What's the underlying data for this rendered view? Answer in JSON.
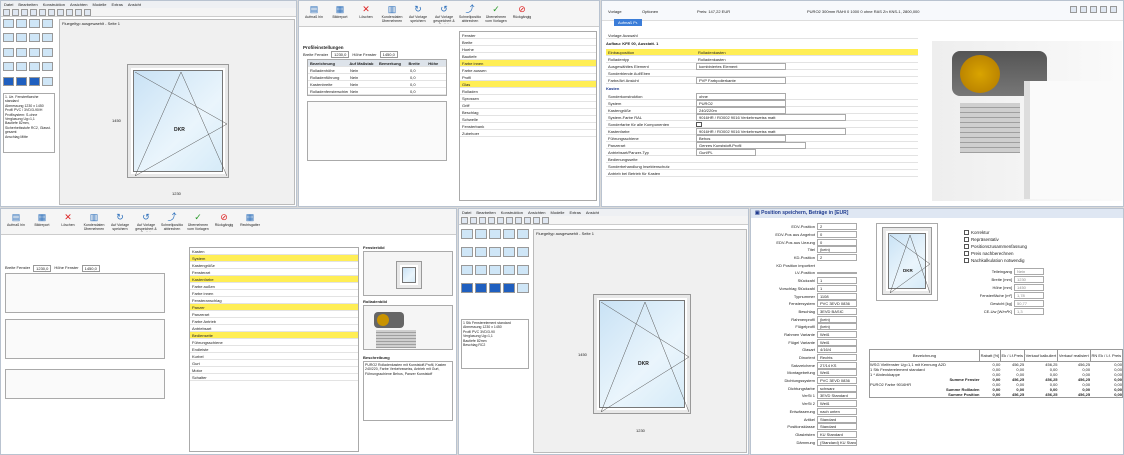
{
  "p1": {
    "menu": [
      "Datei",
      "Bearbeiten",
      "Konstruktion",
      "Ansichten",
      "Modelle",
      "Extras",
      "Ansicht"
    ],
    "tab": "Fluegeltyp ausgewaehlt - Seite 1",
    "win_label": "DKR",
    "info_lines": [
      "1. Ue. Fensterflaeche standard",
      "Abmessung 1230 x 1450",
      "Profil PVC / 3VD/3-90/H",
      "Profilsystem: S-ohne",
      "Verglasung Ug=1,1",
      "Bautiefe 82mm, Sicherheitsstufe RC2, Glasst. gesamt",
      "Anschlag Mitte"
    ],
    "dim_bottom": "1230",
    "dim_side": "1450"
  },
  "p2": {
    "toolbar": [
      "Aufmaß hin",
      "Bildreport",
      "Löschen",
      "Kundendaten Übernehmen",
      "Auf Vorlage speichern",
      "Auf Vorlage gespeichert & Zurück",
      "Schnellpositionen abbrechen",
      "Übernehmen vom Vorlagen",
      "Rückgängig"
    ],
    "section1": "Profileinstellungen",
    "breite_label": "Breite Fenster",
    "breite_val": "1230,0",
    "hoehe_label": "Höhe Fenster",
    "hoehe_val": "1450,0",
    "table_cols": [
      "Bezeichnung",
      "Auf Maßstab",
      "Bemerkung",
      "Breite",
      "Höhe"
    ],
    "table_rows": [
      [
        "Rolladenhöhe",
        "Nein",
        "",
        "0,0"
      ],
      [
        "Rolladenführung",
        "Nein",
        "",
        "0,0"
      ],
      [
        "Kastenbreite",
        "Nein",
        "",
        "0,0"
      ],
      [
        "Rolladenfensterschiene",
        "Nein",
        "",
        "0,0"
      ]
    ],
    "rechts_list": [
      "Fenster",
      "Breite",
      "Hoehe",
      "Bautiefe",
      "Farbe innen",
      "Farbe aussen",
      "Profil",
      "Glas",
      "Rolladen",
      "Sprossen",
      "Griff",
      "Beschlag",
      "Schwelle",
      "Fensterbank",
      "Zubehoer"
    ]
  },
  "p3": {
    "tabs": [
      "Vorlage",
      "Optionen"
    ],
    "tab_active": "Aufmaß Pr.",
    "price": "Preis: 147,22 EUR",
    "title_right": "PURO2 300mm RAHI 0 1000 0 ohne RAS Zn KNS-1, 2800,000",
    "header_line": "Aufbau: KFE 00, Ausstatt. 1",
    "fields": [
      {
        "l": "Vorlage Auswahl",
        "v": ""
      },
      {
        "l": "Einbauposition",
        "v": "Rolladenkasten"
      },
      {
        "l": "Rolladentyp",
        "v": "Rolladenkasten"
      },
      {
        "l": "Ausgewähltes Element",
        "v": "kombiniertes Element"
      },
      {
        "l": "Sonderblende Auf/Eben",
        "v": ""
      },
      {
        "l": "Farbe/Art Ansicht",
        "v": "PVP Farbpolierkante"
      }
    ],
    "section": "Kasten",
    "fields2": [
      {
        "l": "Sonderkonstruktion",
        "v": "ohne"
      },
      {
        "l": "System",
        "v": "PURO2"
      },
      {
        "l": "Kastengröße",
        "v": "240/220m"
      },
      {
        "l": "System-Farbe RAL",
        "v": "9016HR / RO002 9016 Verkehrsweiss matt"
      },
      {
        "l": "Sonderfarbe für alle Komponenten",
        "v": ""
      },
      {
        "l": "Kastenfarbe",
        "v": "9016HR / RO002 9016 Verkehrsweiss matt"
      },
      {
        "l": "Führungsschiene",
        "v": "Behos"
      },
      {
        "l": "Panzerart",
        "v": "Genres Kunststoff-Profil"
      },
      {
        "l": "Antriebsart/Panzer-Typ",
        "v": "Gurt/PL"
      },
      {
        "l": "Bedienungsseite",
        "v": ""
      },
      {
        "l": "Sonderbehandlung Insektenschutz",
        "v": ""
      },
      {
        "l": "Antrieb bei Betrieb für Kasten",
        "v": ""
      }
    ]
  },
  "p4": {
    "toolbar": [
      "Aufmaß hin",
      "Bildreport",
      "Löschen",
      "Kundendaten Übernehmen",
      "Auf Vorlage speichern",
      "Auf Vorlage gespeichert & Zurück",
      "Schnellpositionen abbrechen",
      "Übernehmen vom Vorlagen",
      "Rückgängig",
      "Rechtsgatter"
    ],
    "breite_val": "1230,0",
    "hoehe_val": "1450,0",
    "mid_rows": [
      "Kasten",
      "System",
      "Kastengröße",
      "Fensterart",
      "Kastenfarbe",
      "Farbe außen",
      "Farbe innen",
      "Fensteranschlag",
      "Panzer",
      "Panzerart",
      "Farbe Antrieb",
      "Antriebsart",
      "Bedienseite",
      "Führungsschiene",
      "Endleiste",
      "Kurbel",
      "Gurt",
      "Motor",
      "Schalter"
    ],
    "preview_title": "Fensterbild",
    "preview2_title": "Rolladenbild",
    "desc_title": "Beschreibung",
    "desc": "PURO2 Rolladenkasten mit Kunststoff-Profil, Kasten 240/220, Farbe Verkehrsweiss, Antrieb mit Gurt, Führungsschiene Behos, Panzer Kunststoff"
  },
  "p5": {
    "menu": [
      "Datei",
      "Bearbeiten",
      "Konstruktion",
      "Ansichten",
      "Modelle",
      "Extras",
      "Ansicht"
    ],
    "tab": "Fluegeltyp ausgewaehlt - Seite 1",
    "win_label": "DKR",
    "info_lines": [
      "1 Stk Fensterelement standard",
      "Abmessung 1230 x 1450",
      "Profil PVC 3VD/3-90",
      "Verglasung Ug=1,1",
      "Bautiefe 82mm",
      "Beschlag RC2"
    ],
    "dim_bottom": "1230",
    "dim_side": "1450"
  },
  "p6": {
    "title": "Position speichern, Beträge in [EUR]",
    "fields": [
      {
        "l": "EDV-Position",
        "v": "2"
      },
      {
        "l": "EDV-Pos aus Angebot",
        "v": "0"
      },
      {
        "l": "EDV-Pos aus Uezung",
        "v": "0"
      },
      {
        "l": "Titel",
        "v": "(kein)"
      },
      {
        "l": "KD-Position",
        "v": "2"
      },
      {
        "l": "KD Position importiert",
        "v": ""
      },
      {
        "l": "LV-Position",
        "v": ""
      },
      {
        "l": "Stückzahl",
        "v": "1"
      },
      {
        "l": "Vorschlag Stückzahl",
        "v": "1"
      },
      {
        "l": "Typnummer",
        "v": "1108"
      },
      {
        "l": "Fenstersystem",
        "v": "PVC 3EVD 0836"
      },
      {
        "l": "Beschlag",
        "v": "3EVD BASIC"
      },
      {
        "l": "Rahmenprofil",
        "v": "(kein)"
      },
      {
        "l": "Flügelprofil",
        "v": "(kein)"
      },
      {
        "l": "Rahmen Variante",
        "v": "Weiß"
      },
      {
        "l": "Flügel Variante",
        "v": "Weiß"
      },
      {
        "l": "Glasart",
        "v": "4/16/4"
      },
      {
        "l": "Dinorient",
        "v": "Rechts"
      },
      {
        "l": "Satzzeichene",
        "v": "27/14 KS"
      },
      {
        "l": "Montagebefung",
        "v": "Weiß"
      },
      {
        "l": "Dichtungssystem",
        "v": "PVC 3EVD 0836"
      },
      {
        "l": "Dichtungsfarbe",
        "v": "schwarz"
      },
      {
        "l": "VerSt 1",
        "v": "3EVD Standard"
      },
      {
        "l": "VerSt 2",
        "v": "Weiß"
      },
      {
        "l": "Entwässerung",
        "v": "nach unten"
      },
      {
        "l": "Artikel",
        "v": "Standard"
      },
      {
        "l": "Positionsklasse",
        "v": "Standard"
      },
      {
        "l": "Glasleisten",
        "v": "KU Standard"
      },
      {
        "l": "Dämmung",
        "v": "(Standard) KU Standard"
      },
      {
        "l": "Montageart",
        "v": "(kein)"
      }
    ],
    "checks": [
      "Korrektur",
      "Repräsentativ",
      "Positionszusammenfassung",
      "Preis nachberechnen",
      "Nachkalkulation notwendig"
    ],
    "right_fields": [
      {
        "l": "Teileingang",
        "v": "Nein"
      },
      {
        "l": "Breite [mm]",
        "v": "1230"
      },
      {
        "l": "Höhe [mm]",
        "v": "1450"
      },
      {
        "l": "Fensterfläche [m²]",
        "v": "1,78"
      },
      {
        "l": "Gewicht [kg]",
        "v": "50,77"
      },
      {
        "l": "CE-Uw [W/m²K]",
        "v": "1,3"
      }
    ],
    "preview_label": "DKR",
    "table_cols": [
      "Bezeichnung",
      "Rabatt [%]",
      "Ek / Lf.Preis",
      "Verkauf kalkuliert",
      "Verkauf realisiert",
      "RN Ek / Lf. Preis"
    ],
    "table_rows": [
      [
        "WSG Vielfenster Ug=1,1 mit Kennung A2D",
        "0,00",
        "456,25",
        "456,25",
        "456,25",
        "0,00"
      ],
      [
        "1 Stk Fensterelement standard",
        "0,00",
        "0,00",
        "0,00",
        "0,00",
        "0,00"
      ],
      [
        "1 * Abdeckkappe",
        "0,00",
        "0,00",
        "0,00",
        "0,00",
        "0,00"
      ],
      [
        "Summe Fenster",
        "0,00",
        "456,25",
        "456,25",
        "456,25",
        "0,00"
      ],
      [
        "PURO2 Farbe 9016HR",
        "0,00",
        "0,00",
        "0,00",
        "0,00",
        "0,00"
      ],
      [
        "Summe Rollladen",
        "0,00",
        "0,00",
        "0,00",
        "0,00",
        "0,00"
      ],
      [
        "Summe Position",
        "0,00",
        "456,25",
        "456,25",
        "456,25",
        "0,00"
      ]
    ]
  }
}
